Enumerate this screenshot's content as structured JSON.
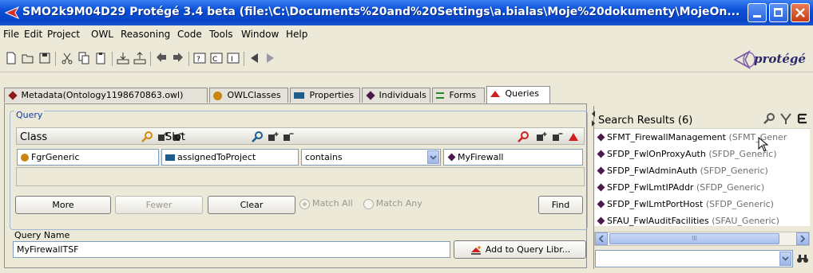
{
  "window": {
    "title": "SMO2k9M04D29  Protégé 3.4 beta    (file:\\C:\\Documents%20and%20Settings\\a.bialas\\Moje%20dokumenty\\MojeOn...",
    "minimize_label": "_",
    "maximize_label": "□",
    "close_label": "✕"
  },
  "menu": [
    "File",
    "Edit",
    "Project",
    "OWL",
    "Reasoning",
    "Code",
    "Tools",
    "Window",
    "Help"
  ],
  "logo": {
    "text": "protégé"
  },
  "tabs": [
    {
      "label": "Metadata(Ontology1198670863.owl)",
      "icon": "diamond-icon",
      "color": "#8b1a1a"
    },
    {
      "label": "OWLClasses",
      "icon": "circle-icon",
      "color": "#c8860f"
    },
    {
      "label": "Properties",
      "icon": "rect-icon",
      "color": "#1c5b8c"
    },
    {
      "label": "Individuals",
      "icon": "diamond-icon",
      "color": "#4b1a4d"
    },
    {
      "label": "Forms",
      "icon": "forms-icon",
      "color": "#2a8a2a"
    },
    {
      "label": "Queries",
      "icon": "triangle-icon",
      "color": "#d02020"
    }
  ],
  "query": {
    "group_label": "Query",
    "class_header": "Class",
    "slot_header": "Slot",
    "class_value": "FgrGeneric",
    "slot_value": "assignedToProject",
    "operator_value": "contains",
    "value_value": "MyFirewall",
    "more_label": "More",
    "fewer_label": "Fewer",
    "clear_label": "Clear",
    "match_all_label": "Match All",
    "match_any_label": "Match Any",
    "find_label": "Find",
    "name_label": "Query Name",
    "name_value": "MyFirewallTSF",
    "add_library_label": "Add to Query Libr..."
  },
  "results": {
    "title": "Search Results (6)",
    "items": [
      {
        "name": "SFMT_FirewallManagement",
        "type": "(SFMT_Gener"
      },
      {
        "name": "SFDP_FwlOnProxyAuth",
        "type": "(SFDP_Generic)"
      },
      {
        "name": "SFDP_FwlAdminAuth",
        "type": "(SFDP_Generic)"
      },
      {
        "name": "SFDP_FwlLmtIPAddr",
        "type": "(SFDP_Generic)"
      },
      {
        "name": "SFDP_FwlLmtPortHost",
        "type": "(SFDP_Generic)"
      },
      {
        "name": "SFAU_FwlAuditFacilities",
        "type": "(SFAU_Generic)"
      }
    ],
    "scroll_thumb_label": "III"
  }
}
